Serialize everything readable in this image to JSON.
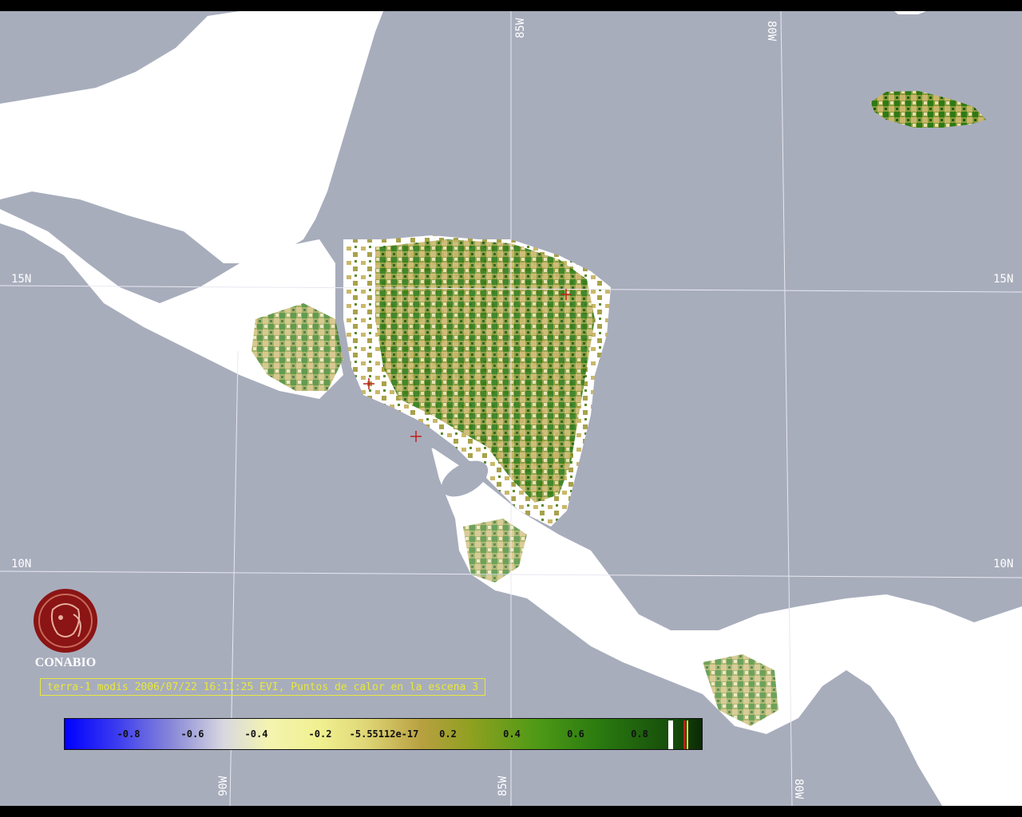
{
  "map": {
    "grid_labels": {
      "lat_15": "15N",
      "lat_10": "10N",
      "lon_85": "85W",
      "lon_80": "80W",
      "lon_90": "90W"
    },
    "colors": {
      "ocean": "#a8adbc",
      "cloud": "#ffffff",
      "vegetation_dark": "#1f6a12",
      "vegetation_light": "#c9b86a",
      "gridline": "#e8e8f0",
      "fire_marker": "#c0201a"
    }
  },
  "logo": {
    "name": "CONABIO",
    "icon": "conabio-seal-icon",
    "color": "#8b1414"
  },
  "caption": {
    "text": "terra-1 modis 2006/07/22 16:11:25 EVI, Puntos de calor en la escena 3"
  },
  "colorbar": {
    "ticks": [
      "-0.8",
      "-0.6",
      "-0.4",
      "-0.2",
      "-5.55112e-17",
      "0.2",
      "0.4",
      "0.6",
      "0.8"
    ]
  }
}
